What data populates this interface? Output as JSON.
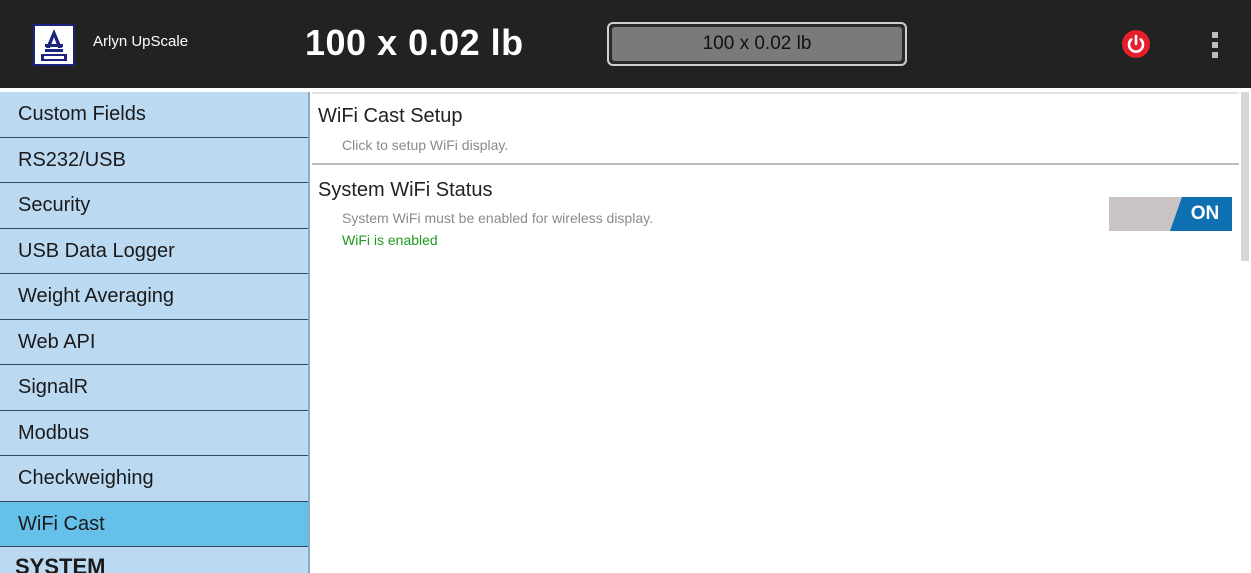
{
  "header": {
    "app_name": "Arlyn UpScale",
    "weight_display": "100 x 0.02 lb",
    "weight_box": "100 x 0.02 lb"
  },
  "sidebar": {
    "items": [
      {
        "label": "Custom Fields"
      },
      {
        "label": "RS232/USB"
      },
      {
        "label": "Security"
      },
      {
        "label": "USB Data Logger"
      },
      {
        "label": "Weight Averaging"
      },
      {
        "label": "Web API"
      },
      {
        "label": "SignalR"
      },
      {
        "label": "Modbus"
      },
      {
        "label": "Checkweighing"
      },
      {
        "label": "WiFi Cast",
        "active": true
      }
    ],
    "section_header": "SYSTEM"
  },
  "main": {
    "wifi_cast_setup": {
      "title": "WiFi Cast Setup",
      "summary": "Click to setup WiFi display."
    },
    "system_wifi_status": {
      "title": "System WiFi Status",
      "summary": "System WiFi must be enabled for wireless display.",
      "status": "WiFi is enabled",
      "toggle_label": "ON"
    }
  },
  "icons": {
    "logo": "arlyn-logo-icon",
    "power": "power-icon",
    "menu": "overflow-menu-icon"
  },
  "colors": {
    "topbar": "#222222",
    "sidebar": "#bcd9f2",
    "sidebar_active": "#66c1ea",
    "power": "#e41e2b",
    "toggle_on": "#0e6fb2",
    "status_green": "#1f9a1f"
  }
}
